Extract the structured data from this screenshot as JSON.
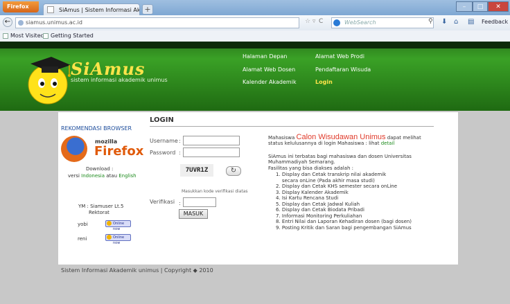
{
  "browser": {
    "menu_button": "Firefox",
    "tab_title": "SiAmus | Sistem Informasi Akademik UN...",
    "url": "siamus.unimus.ac.id",
    "search_placeholder": "WebSearch",
    "feedback": "Feedback",
    "bookmarks": [
      "Most Visited",
      "Getting Started"
    ]
  },
  "header": {
    "logo": "SiAmus",
    "subtitle": "sistem informasi akademik unimus",
    "nav": [
      {
        "label": "Halaman Depan",
        "color": "#ffffff"
      },
      {
        "label": "Alamat Web Prodi",
        "color": "#ffffff"
      },
      {
        "label": "Alamat Web Dosen",
        "color": "#ffffff"
      },
      {
        "label": "Pendaftaran Wisuda",
        "color": "#ffffff"
      },
      {
        "label": "Kalender Akademik",
        "color": "#ffffff"
      },
      {
        "label": "Login",
        "color": "#ffe44a"
      }
    ]
  },
  "sidebar": {
    "title": "REKOMENDASI BROWSER",
    "ff_mozilla": "mozilla",
    "ff_word": "Firefox",
    "download": "Download :",
    "versi_prefix": "versi",
    "indonesia": "Indonesia",
    "atau": "atau",
    "english": "English",
    "ym_label": "YM : Siamuser Lt.5",
    "rektorat": "Rektorat",
    "contacts": [
      {
        "name": "yobi",
        "status": "Online now"
      },
      {
        "name": "reni",
        "status": "Online now"
      }
    ]
  },
  "login": {
    "title": "LOGIN",
    "username_label": "Username",
    "password_label": "Password",
    "colon": ":",
    "captcha": "7UVR1Z",
    "captcha_hint": "Masukkan kode verifikasi diatas",
    "verifikasi_label": "Verifikasi",
    "submit": "MASUK"
  },
  "info": {
    "line1_pre": "Mahasiswa",
    "line1_big": "Calon Wisudawan Unimus",
    "line1_post": "dapat melihat",
    "line2": "status kelulusannya di login Mahasiswa : lihat",
    "line2_link": "detail",
    "desc": "SiAmus ini terbatas bagi mahasiswa dan dosen Universitas Muhammadiyah Semarang.",
    "fasilitas_title": "Fasilitas yang bisa diakses adalah :",
    "fasilitas": [
      "1. Display dan Cetak transkrip nilai akademik",
      "    secara onLine (Pada akhir masa studi)",
      "2. Display dan Cetak KHS semester secara onLine",
      "3. Display Kalender Akademik",
      "4. Isi Kartu Rencana Studi",
      "5. Display dan Cetak Jadwal Kuliah",
      "6. Display dan Cetak Biodata Pribadi",
      "7. Informasi Monitoring Perkuliahan",
      "8. Entri Nilai dan Laporan Kehadiran dosen (bagi dosen)",
      "9. Posting Kritik dan Saran bagi pengembangan SiAmus"
    ]
  },
  "footer": {
    "text": "Sistem Informasi Akademik unimus | Copyright ◆ 2010"
  }
}
